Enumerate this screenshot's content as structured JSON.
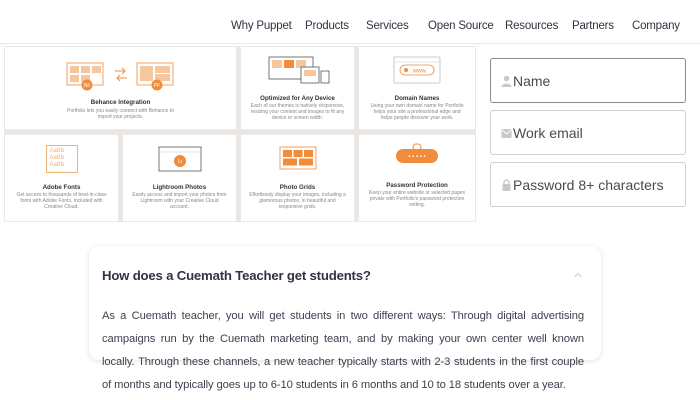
{
  "nav": {
    "items": [
      "Why Puppet",
      "Products",
      "Services",
      "Open Source",
      "Resources",
      "Partners",
      "Company"
    ]
  },
  "features": [
    {
      "id": "behance",
      "title": "Behance Integration",
      "desc": "Portfolio lets you easily connect with Behance to import your projects.",
      "icon": "behance-sync-icon",
      "badge1": "Bē",
      "badge2": "PF"
    },
    {
      "id": "device",
      "title": "Optimized for Any Device",
      "desc": "Each of our themes is natively responsive, resizing your content and images to fit any device or screen width.",
      "icon": "devices-icon"
    },
    {
      "id": "domain",
      "title": "Domain Names",
      "desc": "Using your own domain name for Portfolio helps your site a professional edge and helps people discover your work.",
      "icon": "domain-icon",
      "badge": "www."
    },
    {
      "id": "fonts",
      "title": "Adobe Fonts",
      "desc": "Get access to thousands of best-in-class fonts with Adobe Fonts, included with Creative Cloud.",
      "icon": "fonts-icon",
      "glyph": "AaBb AaBb AaBb"
    },
    {
      "id": "lightroom",
      "title": "Lightroom Photos",
      "desc": "Easily access and import your photos from Lightroom with your Creative Cloud account.",
      "icon": "lightroom-icon",
      "badge": "Lr"
    },
    {
      "id": "grids",
      "title": "Photo Grids",
      "desc": "Effortlessly display your images, including a glamorous photos, in beautiful and responsive grids.",
      "icon": "photo-grid-icon"
    },
    {
      "id": "password",
      "title": "Password Protection",
      "desc": "Keep your entire website or selected pages private with Portfolio's password protection setting.",
      "icon": "password-icon",
      "badge": "• • • • •"
    }
  ],
  "form": {
    "name_placeholder": "Name",
    "email_placeholder": "Work email",
    "password_placeholder": "Password 8+ characters"
  },
  "faq": {
    "question": "How does a Cuemath Teacher get students?",
    "answer": "As a Cuemath teacher, you will get students in two different ways: Through digital advertising campaigns run by the Cuemath marketing team, and by making your own center well known locally. Through these channels, a new teacher typically starts with 2-3 students in the first couple of months and typically goes up to 6-10 students in 6 months and 10 to 18 students over a year."
  },
  "colors": {
    "accent_orange": "#f08c3a",
    "nav_text": "#2e3440",
    "faq_text": "#3d4250"
  }
}
